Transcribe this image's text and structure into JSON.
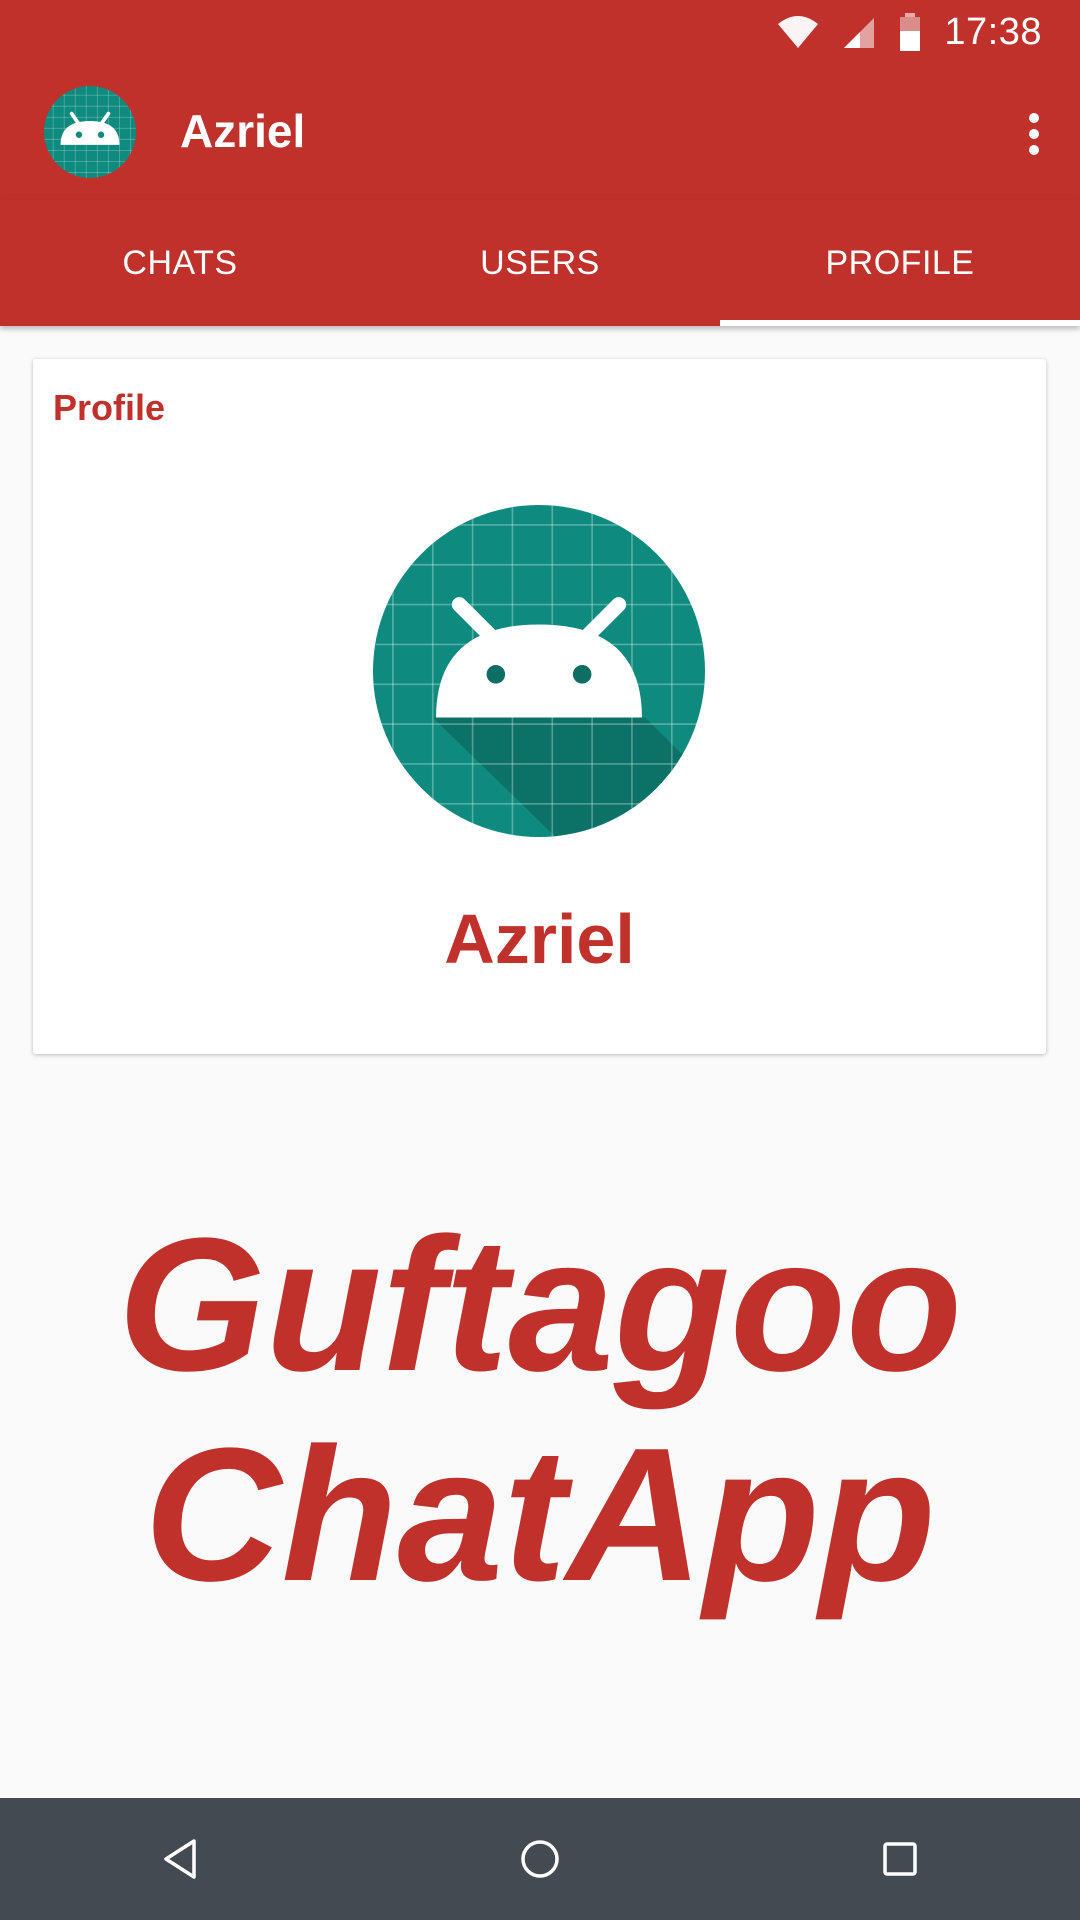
{
  "status_bar": {
    "time": "17:38",
    "icons": [
      "wifi-icon",
      "signal-icon",
      "battery-icon"
    ]
  },
  "app_bar": {
    "title": "Azriel",
    "logo_icon": "android-robot-icon",
    "menu_icon": "more-vert-icon"
  },
  "tabs": [
    {
      "label": "CHATS",
      "active": false
    },
    {
      "label": "USERS",
      "active": false
    },
    {
      "label": "PROFILE",
      "active": true
    }
  ],
  "profile_card": {
    "title": "Profile",
    "avatar_icon": "android-robot-icon",
    "name": "Azriel"
  },
  "brand": {
    "line1": "Guftagoo",
    "line2": "ChatApp"
  },
  "nav_bar": {
    "buttons": [
      "back-icon",
      "home-icon",
      "recents-icon"
    ]
  },
  "colors": {
    "primary": "#c0312c",
    "background": "#fafafa",
    "nav_bar": "#434a51",
    "avatar_teal": "#0f8a7e"
  }
}
